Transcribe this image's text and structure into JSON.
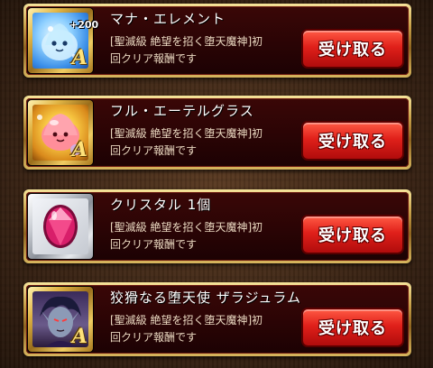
{
  "rewards": [
    {
      "name": "マナ・エレメント",
      "description": "[聖滅級 絶望を招く堕天魔神]初\n回クリア報酬です",
      "button_label": "受け取る",
      "badge": "+200",
      "rank": "A",
      "icon": "mana-element-slime-icon",
      "frame": "gold"
    },
    {
      "name": "フル・エーテルグラス",
      "description": "[聖滅級 絶望を招く堕天魔神]初\n回クリア報酬です",
      "button_label": "受け取る",
      "badge": "",
      "rank": "A",
      "icon": "full-ether-glass-slime-icon",
      "frame": "gold"
    },
    {
      "name": "クリスタル 1個",
      "description": "[聖滅級 絶望を招く堕天魔神]初\n回クリア報酬です",
      "button_label": "受け取る",
      "badge": "",
      "rank": "",
      "icon": "crystal-gem-icon",
      "frame": "silver"
    },
    {
      "name": "狡猾なる堕天使 ザラジュラム",
      "description": "[聖滅級 絶望を招く堕天魔神]初\n回クリア報酬です",
      "button_label": "受け取る",
      "badge": "",
      "rank": "A",
      "icon": "fallen-angel-portrait-icon",
      "frame": "gold"
    }
  ],
  "colors": {
    "button": "#e0201a",
    "card_bg": "#2a0405",
    "gold_frame": "#c9a24a"
  }
}
